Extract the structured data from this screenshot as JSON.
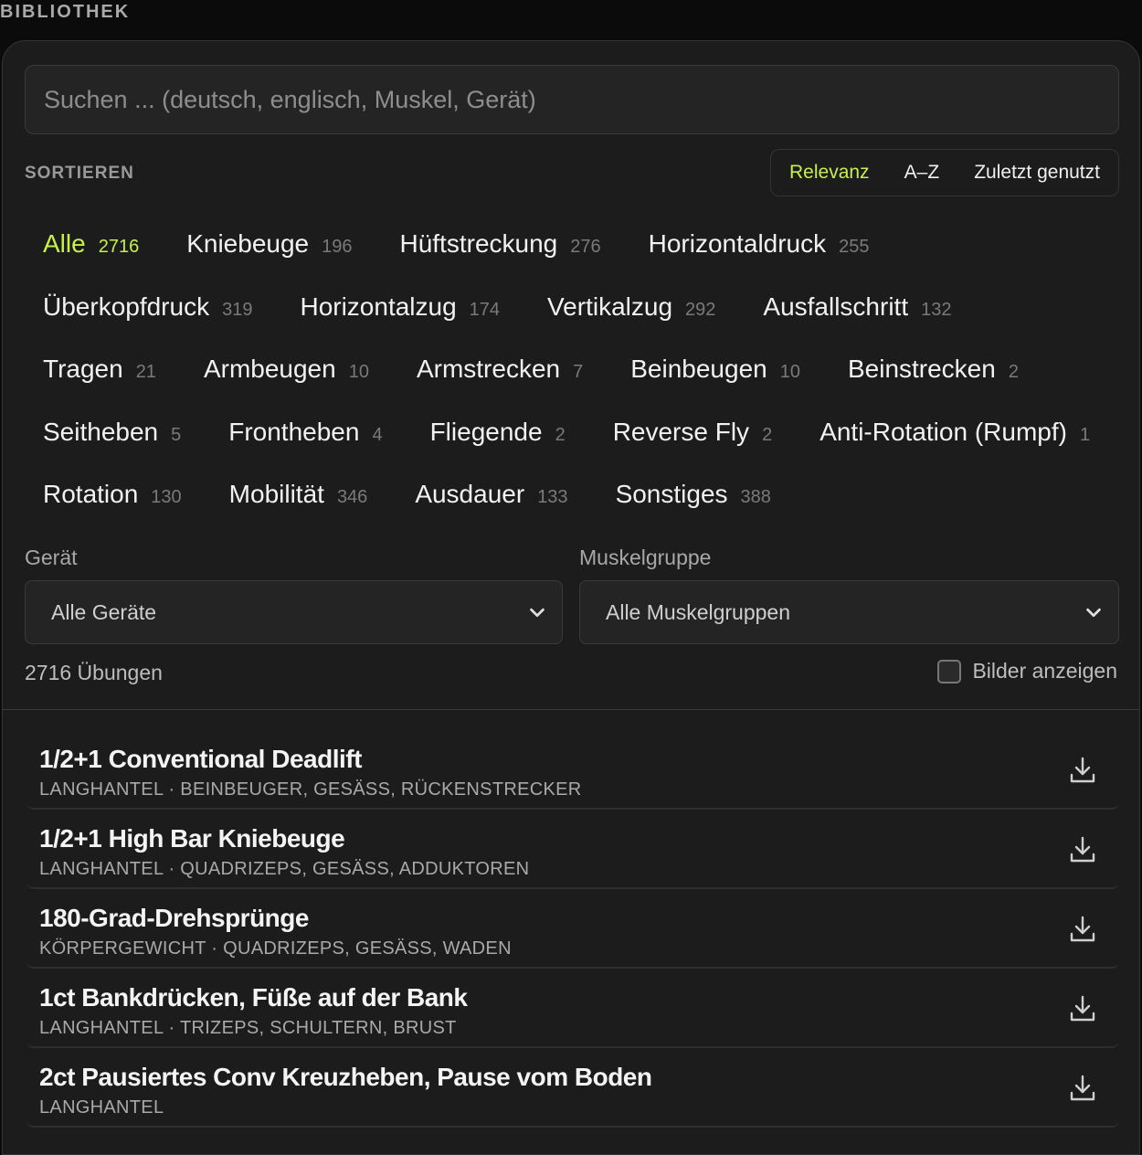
{
  "header": {
    "title": "BIBLIOTHEK"
  },
  "search": {
    "placeholder": "Suchen ... (deutsch, englisch, Muskel, Gerät)",
    "value": ""
  },
  "sort": {
    "label": "SORTIEREN",
    "options": [
      {
        "label": "Relevanz",
        "active": true
      },
      {
        "label": "A–Z",
        "active": false
      },
      {
        "label": "Zuletzt genutzt",
        "active": false
      }
    ]
  },
  "categories": {
    "rows": [
      [
        {
          "name": "Alle",
          "count": "2716",
          "active": true
        },
        {
          "name": "Kniebeuge",
          "count": "196"
        },
        {
          "name": "Hüftstreckung",
          "count": "276"
        },
        {
          "name": "Horizontaldruck",
          "count": "255"
        }
      ],
      [
        {
          "name": "Überkopfdruck",
          "count": "319"
        },
        {
          "name": "Horizontalzug",
          "count": "174"
        },
        {
          "name": "Vertikalzug",
          "count": "292"
        },
        {
          "name": "Ausfallschritt",
          "count": "132"
        }
      ],
      [
        {
          "name": "Tragen",
          "count": "21"
        },
        {
          "name": "Armbeugen",
          "count": "10"
        },
        {
          "name": "Armstrecken",
          "count": "7"
        },
        {
          "name": "Beinbeugen",
          "count": "10"
        },
        {
          "name": "Beinstrecken",
          "count": "2"
        }
      ],
      [
        {
          "name": "Seitheben",
          "count": "5"
        },
        {
          "name": "Frontheben",
          "count": "4"
        },
        {
          "name": "Fliegende",
          "count": "2"
        },
        {
          "name": "Reverse Fly",
          "count": "2"
        },
        {
          "name": "Anti-Rotation (Rumpf)",
          "count": "1"
        }
      ],
      [
        {
          "name": "Rotation",
          "count": "130"
        },
        {
          "name": "Mobilität",
          "count": "346"
        },
        {
          "name": "Ausdauer",
          "count": "133"
        },
        {
          "name": "Sonstiges",
          "count": "388"
        }
      ]
    ]
  },
  "filters": {
    "equipment": {
      "label": "Gerät",
      "value": "Alle Geräte"
    },
    "muscle": {
      "label": "Muskelgruppe",
      "value": "Alle Muskelgruppen"
    }
  },
  "results": {
    "count_label": "2716 Übungen",
    "show_images_label": "Bilder anzeigen",
    "show_images": false
  },
  "exercises": [
    {
      "title": "1/2+1 Conventional Deadlift",
      "subtitle": "LANGHANTEL · BEINBEUGER, GESÄSS, RÜCKENSTRECKER"
    },
    {
      "title": "1/2+1 High Bar Kniebeuge",
      "subtitle": "LANGHANTEL · QUADRIZEPS, GESÄSS, ADDUKTOREN"
    },
    {
      "title": "180-Grad-Drehsprünge",
      "subtitle": "KÖRPERGEWICHT · QUADRIZEPS, GESÄSS, WADEN"
    },
    {
      "title": "1ct Bankdrücken, Füße auf der Bank",
      "subtitle": "LANGHANTEL · TRIZEPS, SCHULTERN, BRUST"
    },
    {
      "title": "2ct Pausiertes Conv Kreuzheben, Pause vom Boden",
      "subtitle": "LANGHANTEL"
    }
  ],
  "colors": {
    "accent": "#c6f04a",
    "panel": "#1c1c1c",
    "background": "#0b0b0b"
  }
}
